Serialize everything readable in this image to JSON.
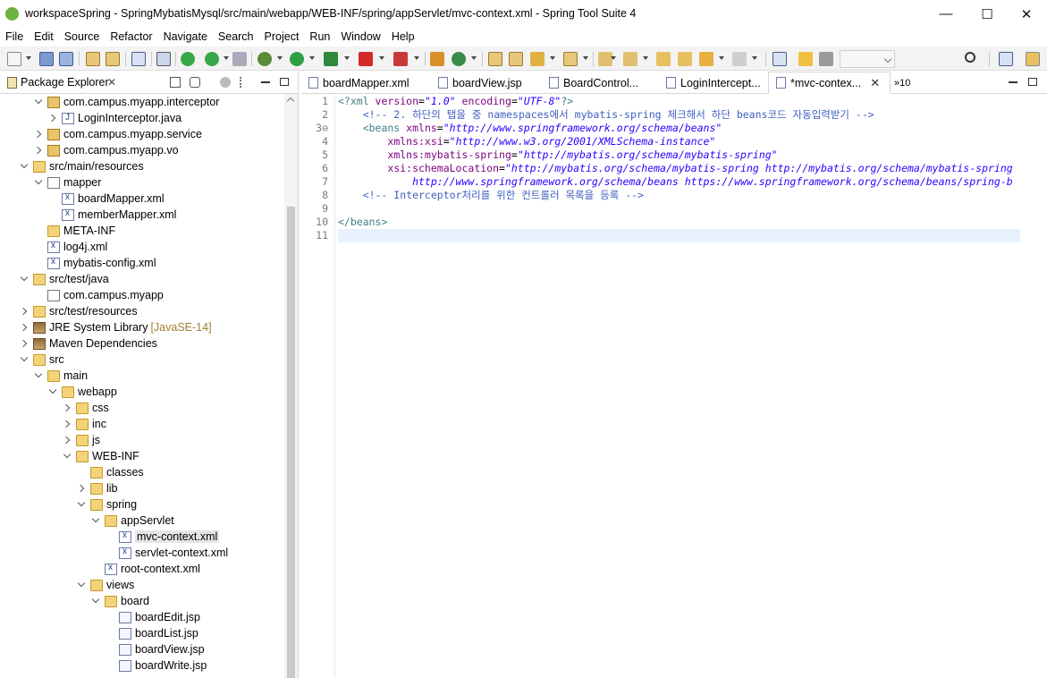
{
  "window": {
    "title": "workspaceSpring - SpringMybatisMysql/src/main/webapp/WEB-INF/spring/appServlet/mvc-context.xml - Spring Tool Suite 4",
    "minimize": "—",
    "maximize": "☐",
    "close": "✕"
  },
  "menu": [
    "File",
    "Edit",
    "Source",
    "Refactor",
    "Navigate",
    "Search",
    "Project",
    "Run",
    "Window",
    "Help"
  ],
  "explorer": {
    "title": "Package Explorer",
    "close": "✕",
    "tree": [
      {
        "label": "com.campus.myapp.interceptor",
        "indent": 2,
        "twist": "open",
        "icon": "package"
      },
      {
        "label": "LoginInterceptor.java",
        "indent": 3,
        "twist": "closed",
        "icon": "java"
      },
      {
        "label": "com.campus.myapp.service",
        "indent": 2,
        "twist": "closed",
        "icon": "package"
      },
      {
        "label": "com.campus.myapp.vo",
        "indent": 2,
        "twist": "closed",
        "icon": "package"
      },
      {
        "label": "src/main/resources",
        "indent": 1,
        "twist": "open",
        "icon": "srcfolder"
      },
      {
        "label": "mapper",
        "indent": 2,
        "twist": "open",
        "icon": "package-empty"
      },
      {
        "label": "boardMapper.xml",
        "indent": 3,
        "twist": "none",
        "icon": "xml"
      },
      {
        "label": "memberMapper.xml",
        "indent": 3,
        "twist": "none",
        "icon": "xml"
      },
      {
        "label": "META-INF",
        "indent": 2,
        "twist": "none",
        "icon": "folder"
      },
      {
        "label": "log4j.xml",
        "indent": 2,
        "twist": "none",
        "icon": "xml"
      },
      {
        "label": "mybatis-config.xml",
        "indent": 2,
        "twist": "none",
        "icon": "xml"
      },
      {
        "label": "src/test/java",
        "indent": 1,
        "twist": "open",
        "icon": "srcfolder"
      },
      {
        "label": "com.campus.myapp",
        "indent": 2,
        "twist": "none",
        "icon": "package-empty"
      },
      {
        "label": "src/test/resources",
        "indent": 1,
        "twist": "closed",
        "icon": "srcfolder"
      },
      {
        "label": "JRE System Library",
        "decor": "[JavaSE-14]",
        "indent": 1,
        "twist": "closed",
        "icon": "lib"
      },
      {
        "label": "Maven Dependencies",
        "indent": 1,
        "twist": "closed",
        "icon": "lib"
      },
      {
        "label": "src",
        "indent": 1,
        "twist": "open",
        "icon": "folder"
      },
      {
        "label": "main",
        "indent": 2,
        "twist": "open",
        "icon": "folder"
      },
      {
        "label": "webapp",
        "indent": 3,
        "twist": "open",
        "icon": "folder"
      },
      {
        "label": "css",
        "indent": 4,
        "twist": "closed",
        "icon": "folder"
      },
      {
        "label": "inc",
        "indent": 4,
        "twist": "closed",
        "icon": "folder"
      },
      {
        "label": "js",
        "indent": 4,
        "twist": "closed",
        "icon": "folder"
      },
      {
        "label": "WEB-INF",
        "indent": 4,
        "twist": "open",
        "icon": "folder"
      },
      {
        "label": "classes",
        "indent": 5,
        "twist": "none",
        "icon": "folder"
      },
      {
        "label": "lib",
        "indent": 5,
        "twist": "closed",
        "icon": "folder"
      },
      {
        "label": "spring",
        "indent": 5,
        "twist": "open",
        "icon": "folder"
      },
      {
        "label": "appServlet",
        "indent": 6,
        "twist": "open",
        "icon": "folder"
      },
      {
        "label": "mvc-context.xml",
        "indent": 7,
        "twist": "none",
        "icon": "xml",
        "selected": true
      },
      {
        "label": "servlet-context.xml",
        "indent": 7,
        "twist": "none",
        "icon": "xml"
      },
      {
        "label": "root-context.xml",
        "indent": 6,
        "twist": "none",
        "icon": "xml"
      },
      {
        "label": "views",
        "indent": 5,
        "twist": "open",
        "icon": "folder"
      },
      {
        "label": "board",
        "indent": 6,
        "twist": "open",
        "icon": "folder"
      },
      {
        "label": "boardEdit.jsp",
        "indent": 7,
        "twist": "none",
        "icon": "jsp"
      },
      {
        "label": "boardList.jsp",
        "indent": 7,
        "twist": "none",
        "icon": "jsp"
      },
      {
        "label": "boardView.jsp",
        "indent": 7,
        "twist": "none",
        "icon": "jsp"
      },
      {
        "label": "boardWrite.jsp",
        "indent": 7,
        "twist": "none",
        "icon": "jsp"
      }
    ]
  },
  "editor": {
    "tabs": [
      {
        "label": "boardMapper.xml",
        "icon": "xml"
      },
      {
        "label": "boardView.jsp",
        "icon": "jsp"
      },
      {
        "label": "BoardControl...",
        "icon": "java"
      },
      {
        "label": "LoginIntercept...",
        "icon": "java"
      },
      {
        "label": "*mvc-contex...",
        "icon": "xml",
        "active": true
      }
    ],
    "overflow_count": "»10",
    "line_numbers": [
      "1",
      "2",
      "3⊖",
      "4",
      "5",
      "6",
      "7",
      "8",
      "9",
      "10",
      "11"
    ],
    "lines": [
      [
        {
          "c": "pi",
          "t": "<?xml "
        },
        {
          "c": "attr",
          "t": "version"
        },
        {
          "c": "",
          "t": "="
        },
        {
          "c": "str",
          "t": "\"1.0\""
        },
        {
          "c": "",
          "t": " "
        },
        {
          "c": "attr",
          "t": "encoding"
        },
        {
          "c": "",
          "t": "="
        },
        {
          "c": "str",
          "t": "\"UTF-8\""
        },
        {
          "c": "pi",
          "t": "?>"
        }
      ],
      [
        {
          "c": "com",
          "t": "    <!-- 2. 하단의 탭을 중 namespaces에서 mybatis-spring 체크해서 하단 beans코드 자동입력받기 -->"
        }
      ],
      [
        {
          "c": "tag",
          "t": "    <beans "
        },
        {
          "c": "attr",
          "t": "xmlns"
        },
        {
          "c": "",
          "t": "="
        },
        {
          "c": "str",
          "t": "\"http://www.springframework.org/schema/beans\""
        }
      ],
      [
        {
          "c": "",
          "t": "        "
        },
        {
          "c": "attr",
          "t": "xmlns:xsi"
        },
        {
          "c": "",
          "t": "="
        },
        {
          "c": "str",
          "t": "\"http://www.w3.org/2001/XMLSchema-instance\""
        }
      ],
      [
        {
          "c": "",
          "t": "        "
        },
        {
          "c": "attr",
          "t": "xmlns:mybatis-spring"
        },
        {
          "c": "",
          "t": "="
        },
        {
          "c": "str",
          "t": "\"http://mybatis.org/schema/mybatis-spring\""
        }
      ],
      [
        {
          "c": "",
          "t": "        "
        },
        {
          "c": "attr",
          "t": "xsi:schemaLocation"
        },
        {
          "c": "",
          "t": "="
        },
        {
          "c": "str",
          "t": "\"http://mybatis.org/schema/mybatis-spring http://mybatis.org/schema/mybatis-spring"
        }
      ],
      [
        {
          "c": "str",
          "t": "            http://www.springframework.org/schema/beans https://www.springframework.org/schema/beans/spring-b"
        }
      ],
      [
        {
          "c": "com",
          "t": "    <!-- Interceptor처리를 위한 컨트롤러 목록을 등록 -->"
        }
      ],
      [
        {
          "c": "",
          "t": ""
        }
      ],
      [
        {
          "c": "tag",
          "t": "</beans>"
        }
      ],
      [
        {
          "c": "",
          "t": ""
        }
      ]
    ]
  }
}
